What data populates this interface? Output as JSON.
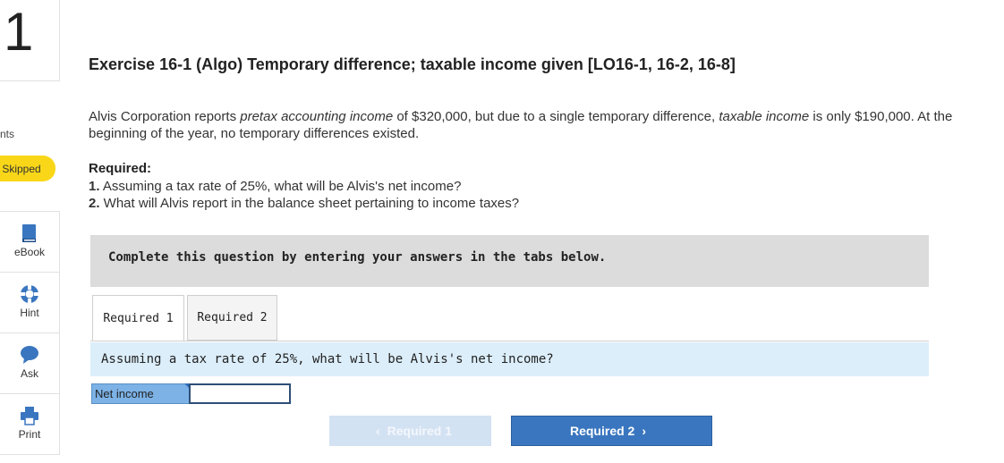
{
  "sidebar": {
    "question_number": "1",
    "points_label": "nts",
    "status_badge": "Skipped",
    "tools": [
      {
        "label": "eBook",
        "icon": "book-icon"
      },
      {
        "label": "Hint",
        "icon": "lifebuoy-icon"
      },
      {
        "label": "Ask",
        "icon": "chat-bubble-icon"
      },
      {
        "label": "Print",
        "icon": "printer-icon"
      }
    ]
  },
  "exercise": {
    "title": "Exercise 16-1 (Algo) Temporary difference; taxable income given [LO16-1, 16-2, 16-8]",
    "para_1": "Alvis Corporation reports ",
    "para_em1": "pretax accounting income",
    "para_2": " of $320,000, but due to a single temporary difference, ",
    "para_em2": "taxable income",
    "para_3": " is only $190,000. At the beginning of the year, no temporary differences existed.",
    "required_heading": "Required:",
    "required_items": [
      {
        "num": "1.",
        "text": " Assuming a tax rate of 25%, what will be Alvis's net income?"
      },
      {
        "num": "2.",
        "text": " What will Alvis report in the balance sheet pertaining to income taxes?"
      }
    ]
  },
  "banner_text": "Complete this question by entering your answers in the tabs below.",
  "tabs": [
    {
      "label": "Required 1",
      "active": true
    },
    {
      "label": "Required 2",
      "active": false
    }
  ],
  "question_text": "Assuming a tax rate of 25%, what will be Alvis's net income?",
  "net_income": {
    "label": "Net income",
    "value": ""
  },
  "nav": {
    "prev_label": "Required 1",
    "next_label": "Required 2",
    "prev_icon": "chevron-left-icon",
    "next_icon": "chevron-right-icon"
  },
  "colors": {
    "accent": "#3a76bf",
    "badge": "#f9d718",
    "question_bg": "#dceefa"
  }
}
